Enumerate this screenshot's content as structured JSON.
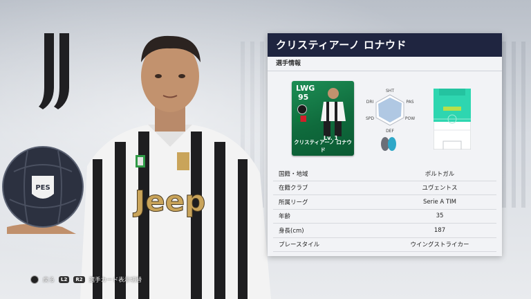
{
  "panel": {
    "title": "クリスティアーノ ロナウド",
    "subtitle": "選手情報"
  },
  "card": {
    "position": "LWG",
    "rating": "95",
    "level": "Lv. 1",
    "name": "クリスティアーノ ロナウド"
  },
  "radar": {
    "labels": [
      "SHT",
      "PAS",
      "POW",
      "DEF",
      "SPD",
      "DRI"
    ]
  },
  "info": {
    "rows": [
      {
        "key": "国籍・地域",
        "value": "ポルトガル"
      },
      {
        "key": "在籍クラブ",
        "value": "ユヴェントス"
      },
      {
        "key": "所属リーグ",
        "value": "Serie A TIM"
      },
      {
        "key": "年齢",
        "value": "35"
      },
      {
        "key": "身長(cm)",
        "value": "187"
      },
      {
        "key": "プレースタイル",
        "value": "ウイングストライカー"
      }
    ]
  },
  "footer": {
    "back_label": "戻る",
    "l2": "L2",
    "r2": "R2",
    "switch_label": "選手カード表示切替"
  },
  "colors": {
    "panel_header": "#1f2540",
    "card_green": "#1d8e55",
    "pitch_cyan": "#2ed6b0"
  }
}
